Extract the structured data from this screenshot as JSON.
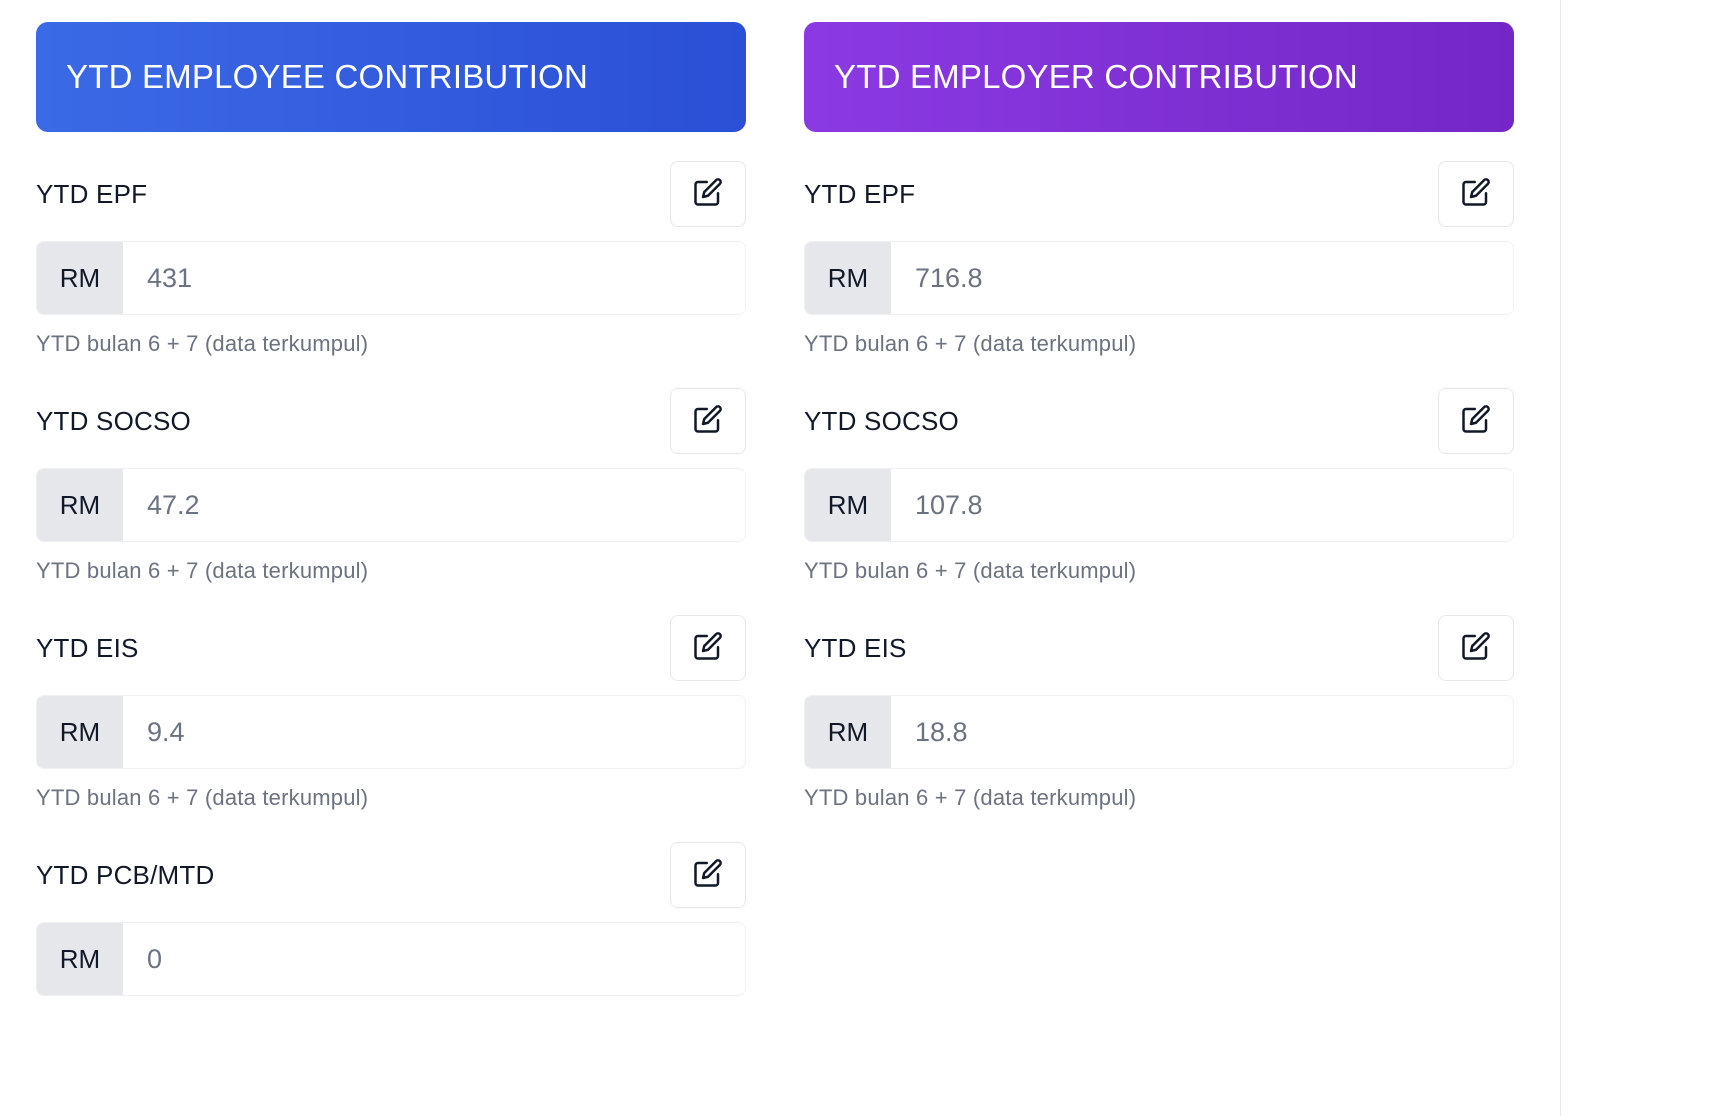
{
  "employee": {
    "title": "YTD EMPLOYEE CONTRIBUTION",
    "fields": [
      {
        "label": "YTD EPF",
        "prefix": "RM",
        "value": "431",
        "hint": "YTD bulan 6 + 7 (data terkumpul)"
      },
      {
        "label": "YTD SOCSO",
        "prefix": "RM",
        "value": "47.2",
        "hint": "YTD bulan 6 + 7 (data terkumpul)"
      },
      {
        "label": "YTD EIS",
        "prefix": "RM",
        "value": "9.4",
        "hint": "YTD bulan 6 + 7 (data terkumpul)"
      },
      {
        "label": "YTD PCB/MTD",
        "prefix": "RM",
        "value": "0"
      }
    ]
  },
  "employer": {
    "title": "YTD EMPLOYER CONTRIBUTION",
    "fields": [
      {
        "label": "YTD EPF",
        "prefix": "RM",
        "value": "716.8",
        "hint": "YTD bulan 6 + 7 (data terkumpul)"
      },
      {
        "label": "YTD SOCSO",
        "prefix": "RM",
        "value": "107.8",
        "hint": "YTD bulan 6 + 7 (data terkumpul)"
      },
      {
        "label": "YTD EIS",
        "prefix": "RM",
        "value": "18.8",
        "hint": "YTD bulan 6 + 7 (data terkumpul)"
      }
    ]
  },
  "icons": {
    "edit": "edit-icon"
  },
  "colors": {
    "employee_header": "#2f5ddf",
    "employer_header": "#7f30d6",
    "prefix_bg": "#e5e7eb",
    "hint_text": "#6b7280"
  }
}
